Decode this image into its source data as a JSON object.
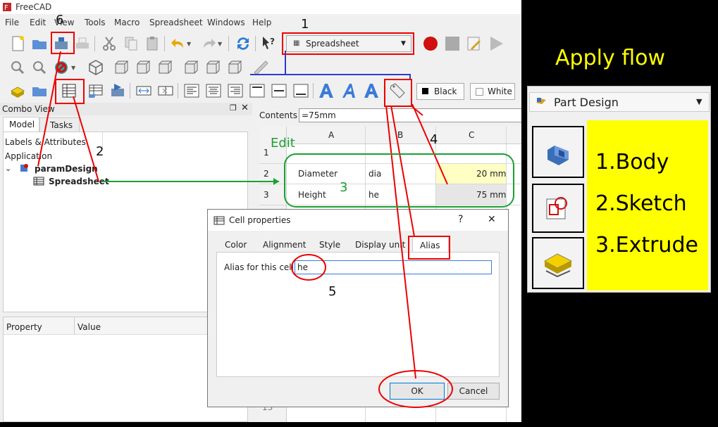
{
  "window": {
    "title": "FreeCAD"
  },
  "menu": [
    "File",
    "Edit",
    "View",
    "Tools",
    "Macro",
    "Spreadsheet",
    "Windows",
    "Help"
  ],
  "workbench": {
    "selected": "Spreadsheet"
  },
  "colors": {
    "black_label": "Black",
    "white_label": "White"
  },
  "combo": {
    "title": "Combo View",
    "tabs": [
      "Model",
      "Tasks"
    ],
    "labels": "Labels & Attributes",
    "application": "Application",
    "doc": "paramDesign",
    "sheet": "Spreadsheet",
    "property_col": "Property",
    "value_col": "Value"
  },
  "sheet": {
    "contents_label": "Contents",
    "contents_value": "=75mm",
    "columns": [
      "A",
      "B",
      "C"
    ],
    "rows": [
      {
        "num": "1",
        "a": "",
        "b": "",
        "c": ""
      },
      {
        "num": "2",
        "a": "Diameter",
        "b": "dia",
        "c": "20 mm"
      },
      {
        "num": "3",
        "a": "Height",
        "b": "he",
        "c": "75 mm"
      }
    ],
    "row_13": "13"
  },
  "dialog": {
    "title": "Cell properties",
    "help": "?",
    "close": "✕",
    "tabs": [
      "Color",
      "Alignment",
      "Style",
      "Display unit",
      "Alias"
    ],
    "alias_label": "Alias for this cell",
    "alias_value": "he",
    "ok": "OK",
    "cancel": "Cancel"
  },
  "annotations": {
    "n1": "1",
    "n2": "2",
    "n3": "3",
    "n4": "4",
    "n5": "5",
    "n6": "6",
    "edit": "Edit"
  },
  "right": {
    "heading": "Apply flow",
    "workbench": "Part Design",
    "steps": [
      "1.Body",
      "2.Sketch",
      "3.Extrude"
    ]
  }
}
